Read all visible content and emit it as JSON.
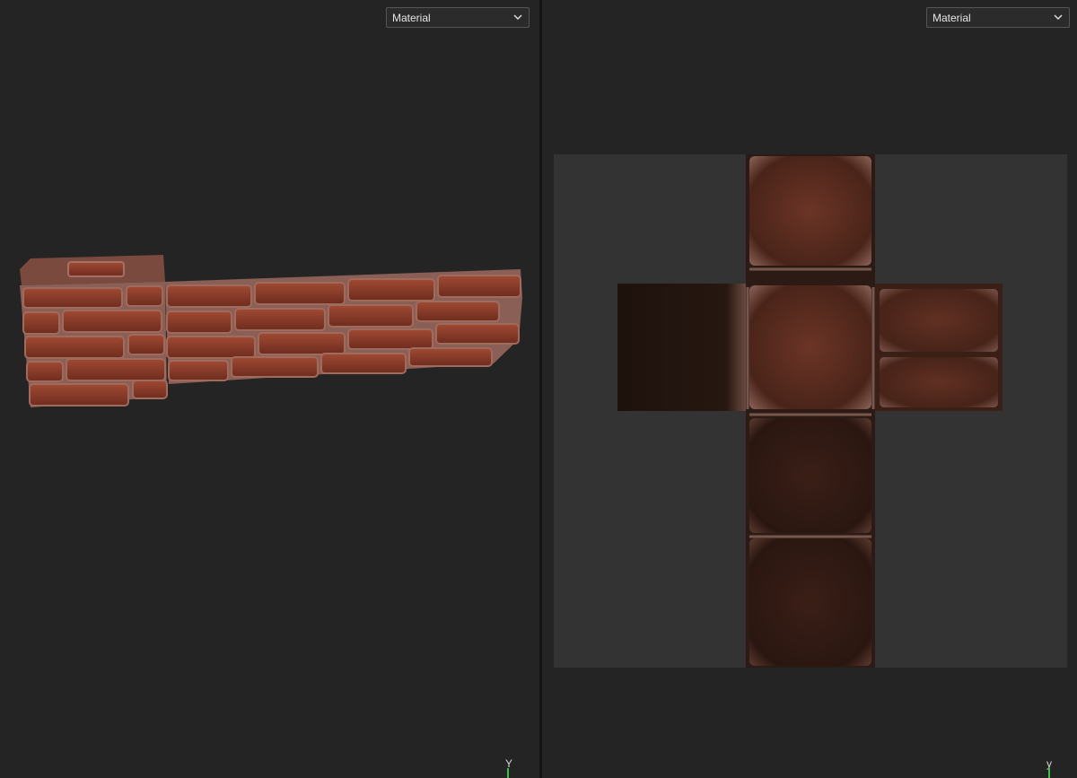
{
  "viewports": {
    "left": {
      "mode": "Material",
      "axis_label": "Y"
    },
    "right": {
      "mode": "Material",
      "axis_label": "y"
    }
  },
  "icons": {
    "dropdown": "chevron-down-icon",
    "axis": "axis-gizmo-icon"
  },
  "colors": {
    "viewport_bg": "#242424",
    "uv_canvas": "#333333",
    "brick": "#8a3a28",
    "mortar": "#9a6a5c",
    "axis_y": "#3fbf4a"
  }
}
